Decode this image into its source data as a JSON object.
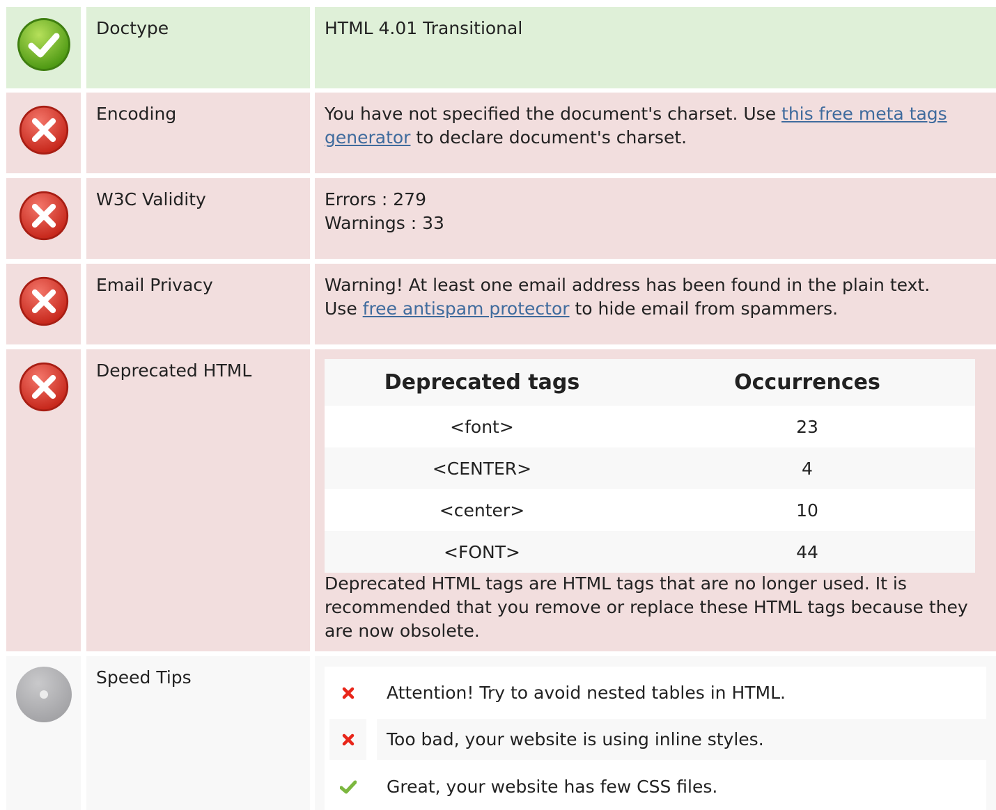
{
  "rows": [
    {
      "status": "pass",
      "label": "Doctype",
      "value": "HTML 4.01 Transitional"
    },
    {
      "status": "fail",
      "label": "Encoding",
      "value_before": "You have not specified the document's charset. Use ",
      "link": "this free meta tags generator",
      "value_after": " to declare document's charset."
    },
    {
      "status": "fail",
      "label": "W3C Validity",
      "errors": "Errors : 279",
      "warnings": "Warnings : 33"
    },
    {
      "status": "fail",
      "label": "Email Privacy",
      "line1": "Warning! At least one email address has been found in the plain text.",
      "line2_before": "Use ",
      "link": "free antispam protector",
      "line2_after": " to hide email from spammers."
    },
    {
      "status": "fail",
      "label": "Deprecated HTML",
      "table": {
        "headers": [
          "Deprecated tags",
          "Occurrences"
        ],
        "rows": [
          [
            "<font>",
            "23"
          ],
          [
            "<CENTER>",
            "4"
          ],
          [
            "<center>",
            "10"
          ],
          [
            "<FONT>",
            "44"
          ]
        ]
      },
      "note": "Deprecated HTML tags are HTML tags that are no longer used. It is recommended that you remove or replace these HTML tags because they are now obsolete."
    },
    {
      "status": "info",
      "label": "Speed Tips",
      "tips": [
        {
          "icon": "cross-icon",
          "text": "Attention! Try to avoid nested tables in HTML."
        },
        {
          "icon": "cross-icon",
          "text": "Too bad, your website is using inline styles."
        },
        {
          "icon": "check-icon",
          "text": "Great, your website has few CSS files."
        }
      ]
    }
  ],
  "colors": {
    "pass_bg": "#dff0d8",
    "fail_bg": "#f2dede",
    "info_bg": "#f8f8f8",
    "link": "#3f6b9d",
    "cross": "#e8261a",
    "check": "#7cb73f"
  }
}
